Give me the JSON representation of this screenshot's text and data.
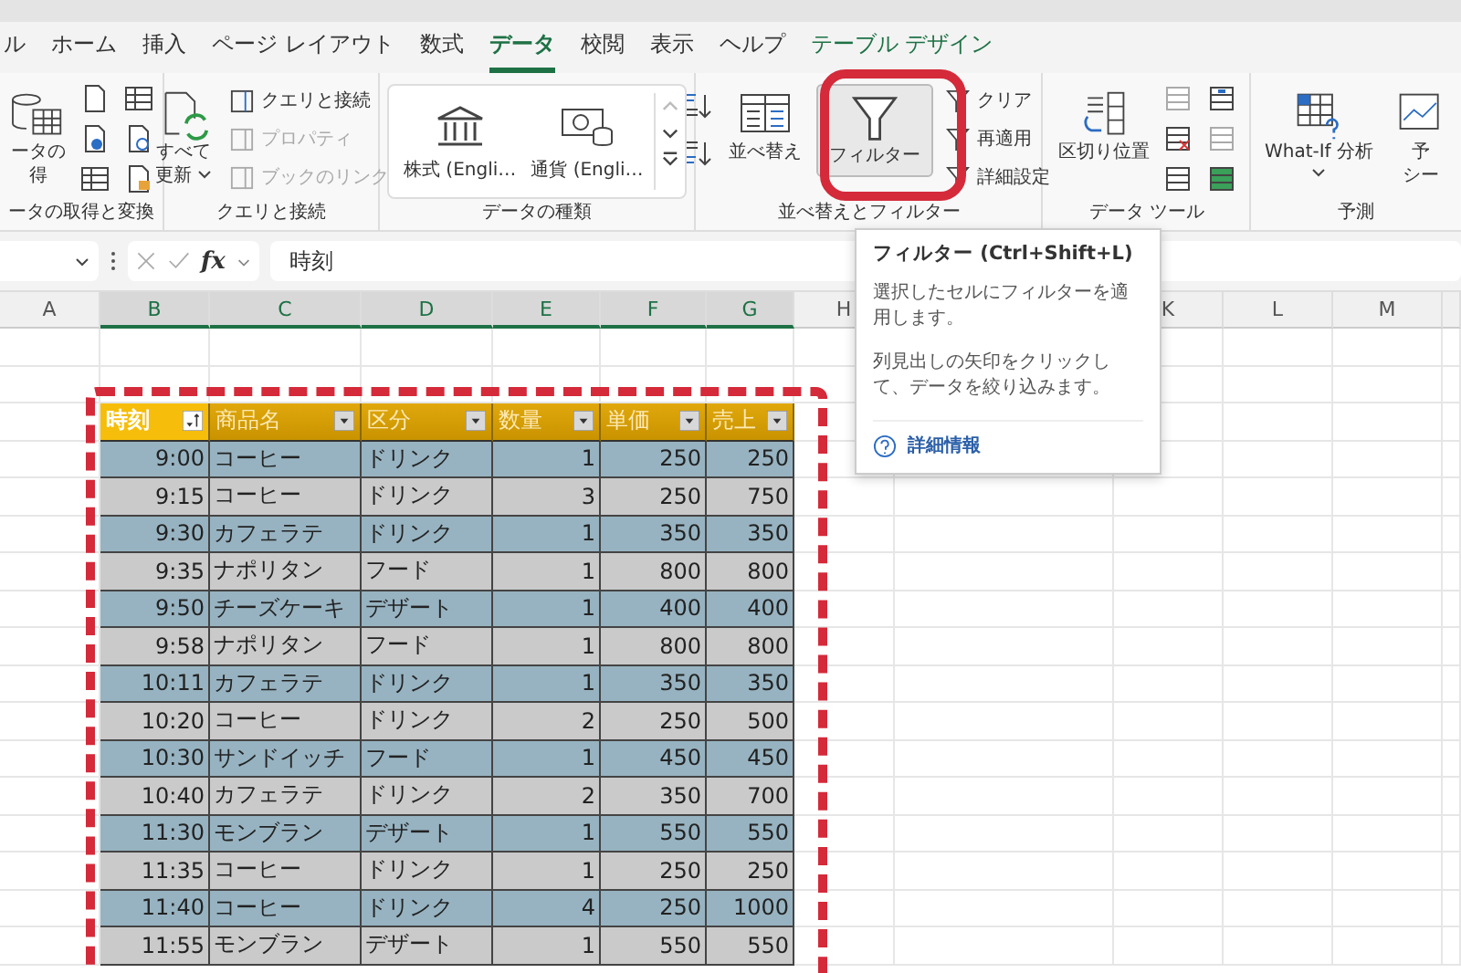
{
  "tabs": [
    {
      "label": "ル",
      "selected": false,
      "kind": "normal"
    },
    {
      "label": "ホーム",
      "selected": false,
      "kind": "normal"
    },
    {
      "label": "挿入",
      "selected": false,
      "kind": "normal"
    },
    {
      "label": "ページ レイアウト",
      "selected": false,
      "kind": "normal"
    },
    {
      "label": "数式",
      "selected": false,
      "kind": "normal"
    },
    {
      "label": "データ",
      "selected": true,
      "kind": "normal"
    },
    {
      "label": "校閲",
      "selected": false,
      "kind": "normal"
    },
    {
      "label": "表示",
      "selected": false,
      "kind": "normal"
    },
    {
      "label": "ヘルプ",
      "selected": false,
      "kind": "normal"
    },
    {
      "label": "テーブル デザイン",
      "selected": false,
      "kind": "contextual"
    }
  ],
  "ribbon": {
    "groups": [
      {
        "kind": "get_data",
        "label": "ータの取得と変換",
        "big_button": [
          "ータの",
          "得"
        ]
      },
      {
        "kind": "queries",
        "label": "クエリと接続",
        "big_button": [
          "すべて",
          "更新"
        ],
        "items": [
          {
            "label": "クエリと接続",
            "disabled": false
          },
          {
            "label": "プロパティ",
            "disabled": true
          },
          {
            "label": "ブックのリンク",
            "disabled": true
          }
        ]
      },
      {
        "kind": "data_types",
        "label": "データの種類",
        "items": [
          {
            "label": "株式 (Engli…"
          },
          {
            "label": "通貨 (Engli…"
          }
        ]
      },
      {
        "kind": "sort_filter",
        "label": "並べ替えとフィルター",
        "sort_label": "並べ替え",
        "filter": {
          "label": "フィルター",
          "selected": true
        },
        "items": [
          {
            "label": "クリア"
          },
          {
            "label": "再適用"
          },
          {
            "label": "詳細設定"
          }
        ]
      },
      {
        "kind": "data_tools",
        "label": "データ ツール",
        "big_button": [
          "区切り位置"
        ]
      },
      {
        "kind": "forecast",
        "label": "予測",
        "big_button": [
          "What-If 分析"
        ],
        "cut_button": [
          "予",
          "シー"
        ]
      }
    ]
  },
  "formula_bar": {
    "function_label": "fx",
    "value": "時刻"
  },
  "columns": [
    {
      "label": "A",
      "selected": false
    },
    {
      "label": "B",
      "selected": true
    },
    {
      "label": "C",
      "selected": true
    },
    {
      "label": "D",
      "selected": true
    },
    {
      "label": "E",
      "selected": true
    },
    {
      "label": "F",
      "selected": true
    },
    {
      "label": "G",
      "selected": true
    },
    {
      "label": "H",
      "selected": false
    },
    {
      "label": "K",
      "selected": false
    },
    {
      "label": "L",
      "selected": false
    },
    {
      "label": "M",
      "selected": false
    }
  ],
  "table": {
    "columns": [
      {
        "label": "時刻",
        "sorted": true
      },
      {
        "label": "商品名",
        "sorted": false
      },
      {
        "label": "区分",
        "sorted": false
      },
      {
        "label": "数量",
        "sorted": false
      },
      {
        "label": "単価",
        "sorted": false
      },
      {
        "label": "売上",
        "sorted": false
      }
    ],
    "rows": [
      [
        "9:00",
        "コーヒー",
        "ドリンク",
        "1",
        "250",
        "250"
      ],
      [
        "9:15",
        "コーヒー",
        "ドリンク",
        "3",
        "250",
        "750"
      ],
      [
        "9:30",
        "カフェラテ",
        "ドリンク",
        "1",
        "350",
        "350"
      ],
      [
        "9:35",
        "ナポリタン",
        "フード",
        "1",
        "800",
        "800"
      ],
      [
        "9:50",
        "チーズケーキ",
        "デザート",
        "1",
        "400",
        "400"
      ],
      [
        "9:58",
        "ナポリタン",
        "フード",
        "1",
        "800",
        "800"
      ],
      [
        "10:11",
        "カフェラテ",
        "ドリンク",
        "1",
        "350",
        "350"
      ],
      [
        "10:20",
        "コーヒー",
        "ドリンク",
        "2",
        "250",
        "500"
      ],
      [
        "10:30",
        "サンドイッチ",
        "フード",
        "1",
        "450",
        "450"
      ],
      [
        "10:40",
        "カフェラテ",
        "ドリンク",
        "2",
        "350",
        "700"
      ],
      [
        "11:30",
        "モンブラン",
        "デザート",
        "1",
        "550",
        "550"
      ],
      [
        "11:35",
        "コーヒー",
        "ドリンク",
        "1",
        "250",
        "250"
      ],
      [
        "11:40",
        "コーヒー",
        "ドリンク",
        "4",
        "250",
        "1000"
      ],
      [
        "11:55",
        "モンブラン",
        "デザート",
        "1",
        "550",
        "550"
      ]
    ]
  },
  "tooltip": {
    "title": "フィルター (Ctrl+Shift+L)",
    "paragraphs": [
      "選択したセルにフィルターを適用します。",
      "列見出しの矢印をクリックして、データを絞り込みます。"
    ],
    "link": "詳細情報"
  }
}
